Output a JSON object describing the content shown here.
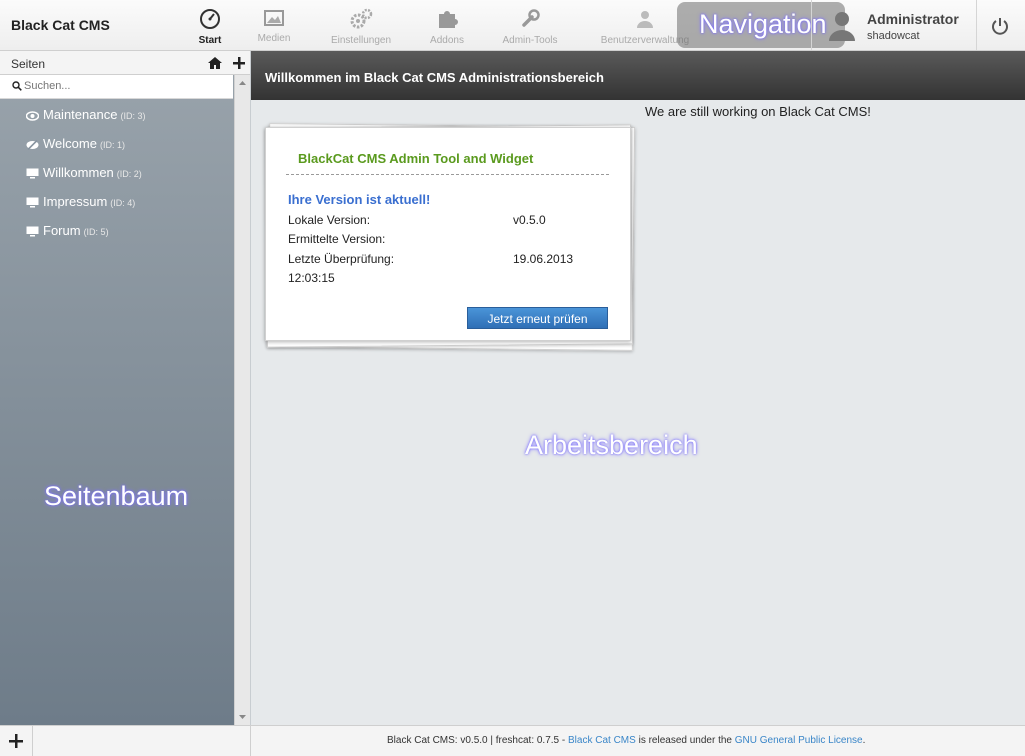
{
  "app": {
    "brand": "Black Cat CMS"
  },
  "nav": {
    "items": [
      {
        "label": "Start",
        "icon": "dashboard-icon"
      },
      {
        "label": "Medien",
        "icon": "image-icon"
      },
      {
        "label": "Einstellungen",
        "icon": "gears-icon"
      },
      {
        "label": "Addons",
        "icon": "puzzle-icon"
      },
      {
        "label": "Admin-Tools",
        "icon": "wrench-icon"
      },
      {
        "label": "Benutzerverwaltung",
        "icon": "users-icon"
      }
    ],
    "overlay_label": "Navigation"
  },
  "user": {
    "display_name": "Administrator",
    "login": "shadowcat",
    "icon": "user-icon"
  },
  "sidebar": {
    "title": "Seiten",
    "search_placeholder": "Suchen...",
    "pages": [
      {
        "label": "Maintenance",
        "id": "(ID: 3)",
        "icon": "eye-icon"
      },
      {
        "label": "Welcome",
        "id": "(ID: 1)",
        "icon": "eye-hidden-icon"
      },
      {
        "label": "Willkommen",
        "id": "(ID: 2)",
        "icon": "monitor-icon"
      },
      {
        "label": "Impressum",
        "id": "(ID: 4)",
        "icon": "monitor-icon"
      },
      {
        "label": "Forum",
        "id": "(ID: 5)",
        "icon": "monitor-icon"
      }
    ],
    "overlay_label": "Seitenbaum"
  },
  "main": {
    "header": "Willkommen im Black Cat CMS Administrationsbereich",
    "notice": "We are still working on Black Cat CMS!",
    "overlay_label": "Arbeitsbereich",
    "widget": {
      "title": "BlackCat CMS Admin Tool and Widget",
      "status": "Ihre Version ist aktuell!",
      "local_label": "Lokale Version:",
      "local_value": "v0.5.0",
      "detected_label": "Ermittelte Version:",
      "detected_value": "",
      "last_check_label": "Letzte Überprüfung:",
      "last_check_date": "19.06.2013",
      "last_check_time": "12:03:15",
      "button_label": "Jetzt erneut prüfen"
    }
  },
  "footer": {
    "prefix": "Black Cat CMS: v0.5.0 | freshcat: 0.7.5 - ",
    "cms_link": "Black Cat CMS",
    "middle": " is released under the ",
    "license_link": "GNU General Public License",
    "suffix": "."
  },
  "colors": {
    "accent_green": "#5a9a1e",
    "accent_blue": "#3a6fd0",
    "button_blue": "#2f6fb6",
    "header_dark": "#333333"
  }
}
